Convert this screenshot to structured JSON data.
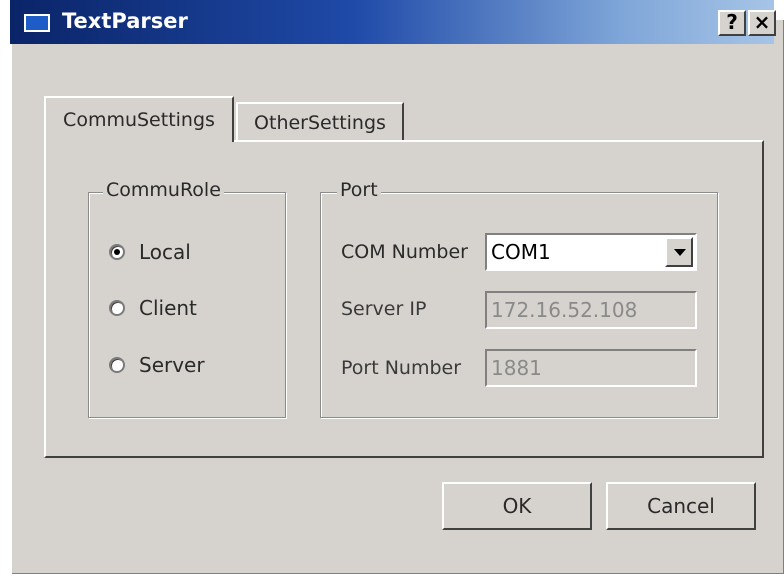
{
  "window": {
    "title": "TextParser",
    "help_label": "?",
    "close_label": "×"
  },
  "tabs": [
    {
      "label": "CommuSettings",
      "active": true
    },
    {
      "label": "OtherSettings",
      "active": false
    }
  ],
  "commu_role": {
    "label": "CommuRole",
    "options": [
      {
        "label": "Local",
        "selected": true
      },
      {
        "label": "Client",
        "selected": false
      },
      {
        "label": "Server",
        "selected": false
      }
    ]
  },
  "port": {
    "label": "Port",
    "com_number": {
      "label": "COM Number",
      "value": "COM1"
    },
    "server_ip": {
      "label": "Server IP",
      "value": "172.16.52.108",
      "enabled": false
    },
    "port_number": {
      "label": "Port Number",
      "value": "1881",
      "enabled": false
    }
  },
  "buttons": {
    "ok": "OK",
    "cancel": "Cancel"
  }
}
